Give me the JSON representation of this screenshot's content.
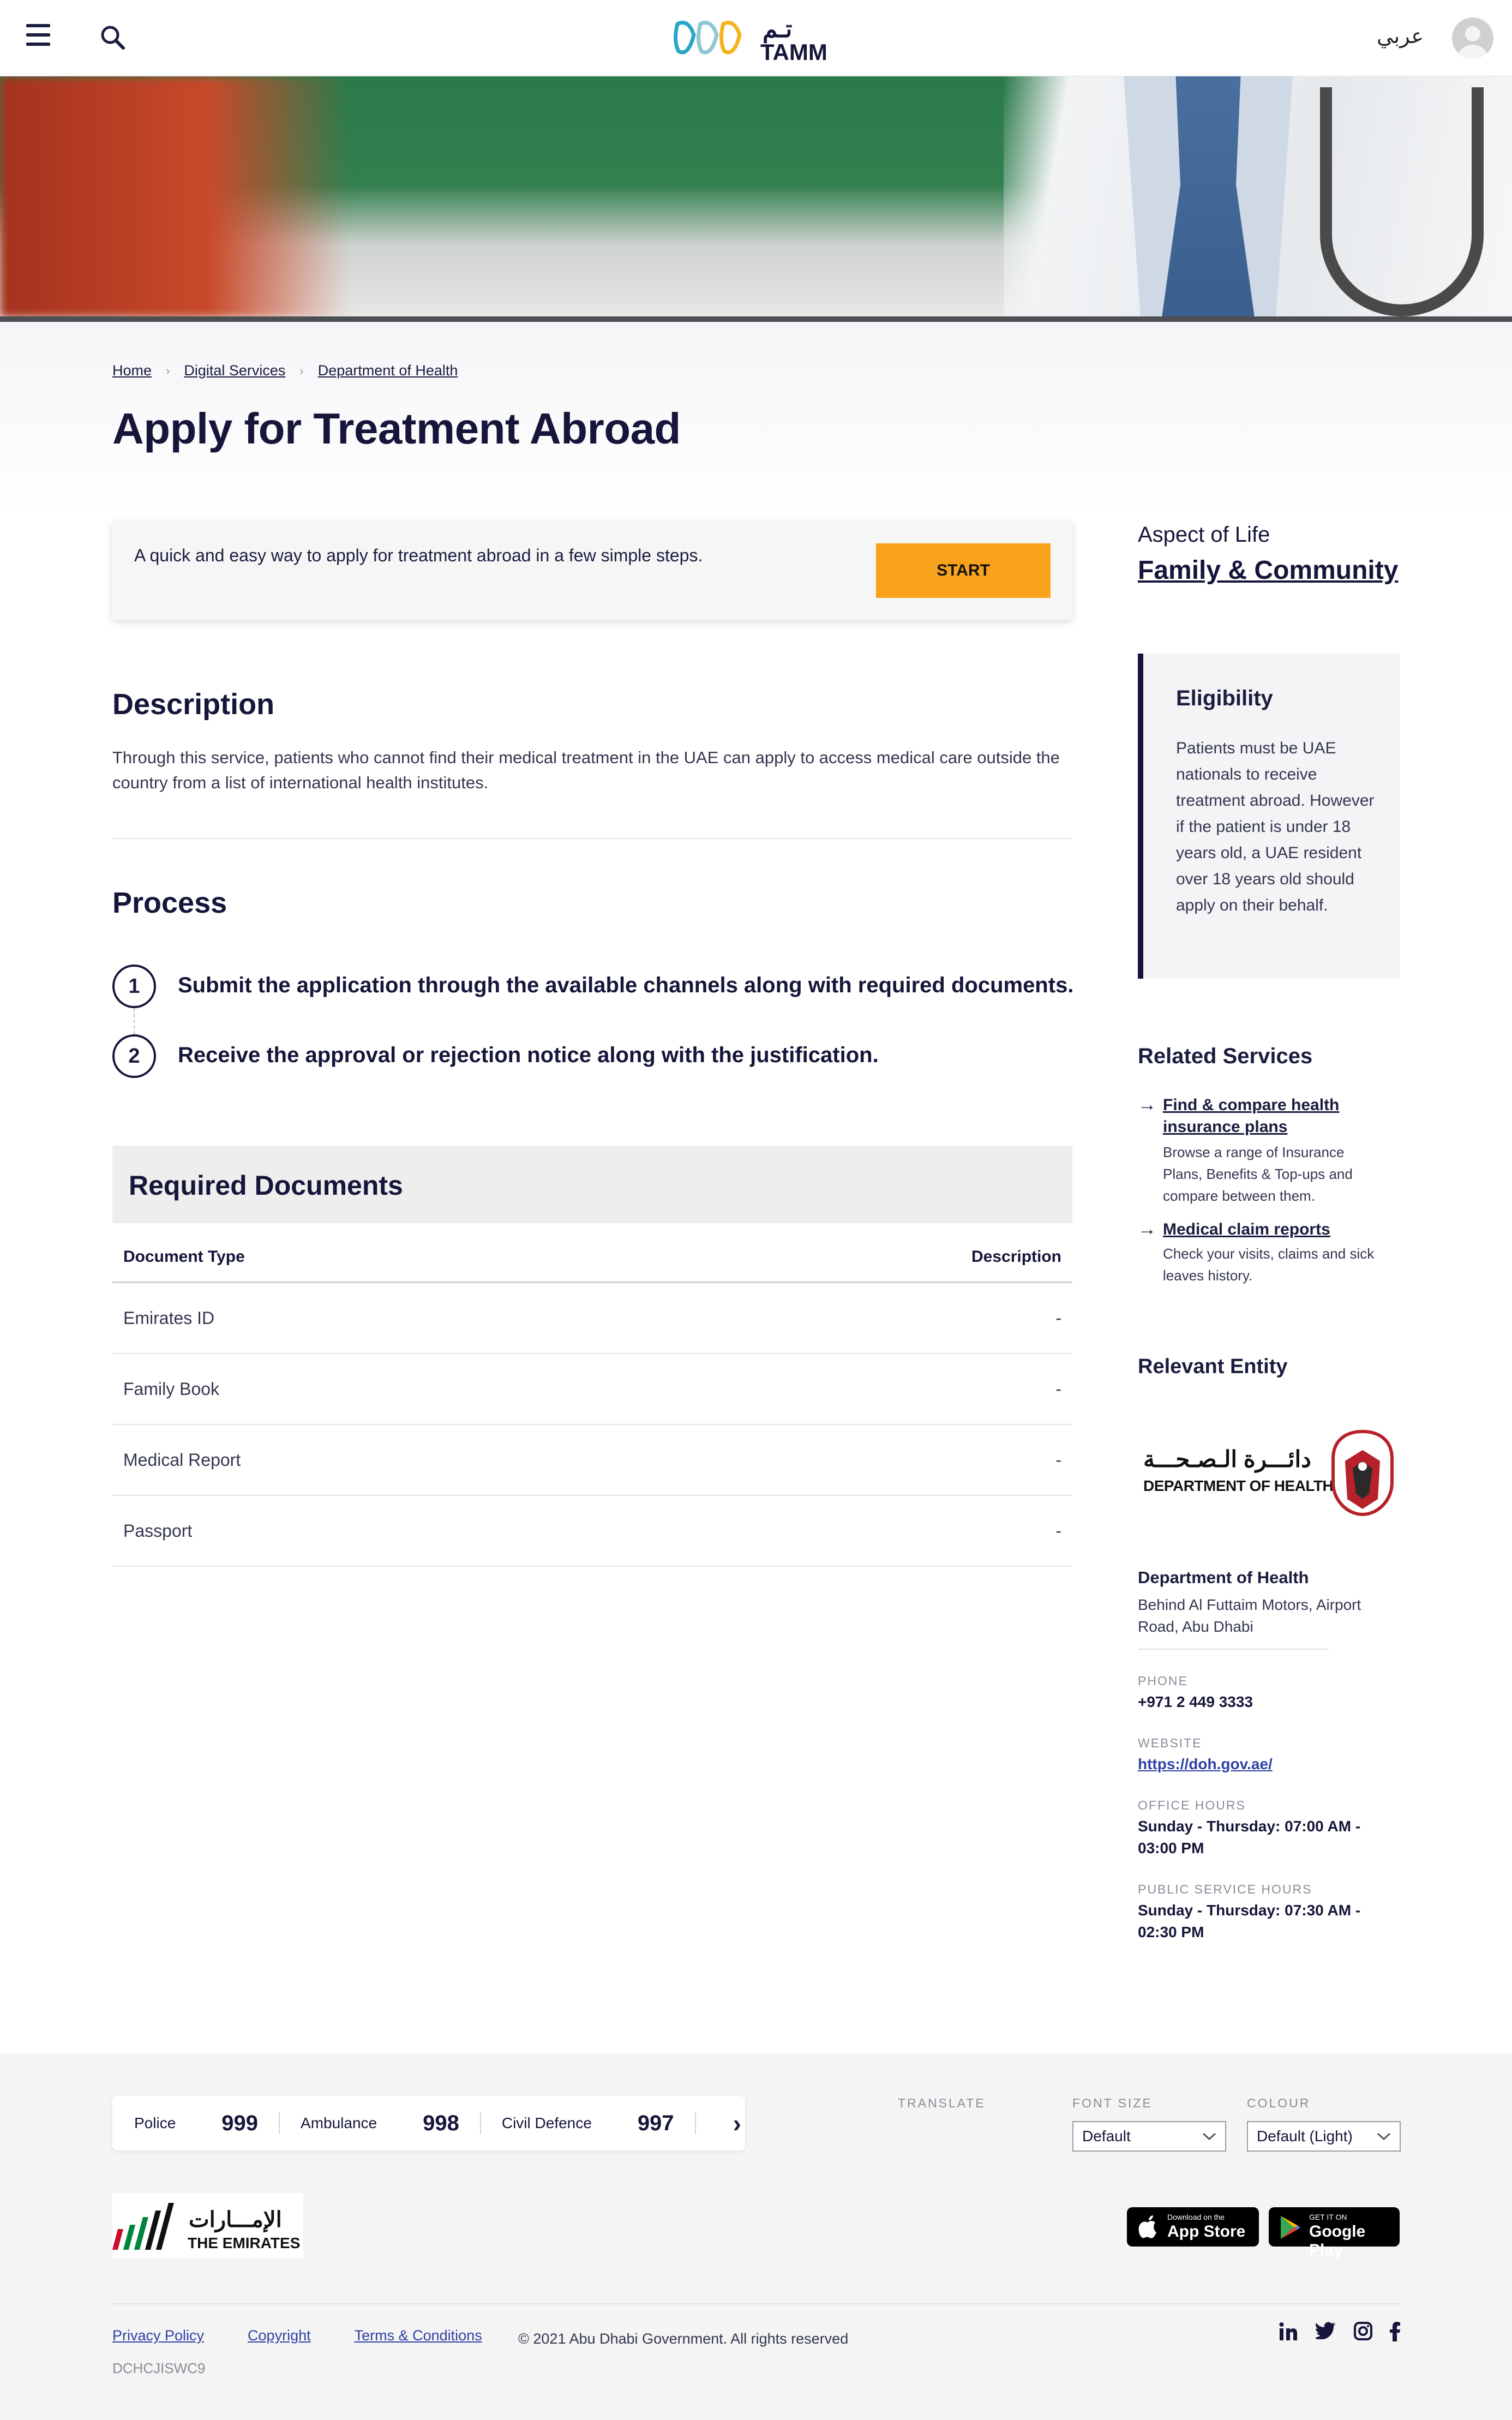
{
  "header": {
    "brand_arabic": "تـم",
    "brand": "TAMM",
    "language": "عربي"
  },
  "breadcrumb": [
    "Home",
    "Digital Services",
    "Department of Health"
  ],
  "page_title": "Apply for Treatment Abroad",
  "start_card": {
    "text": "A quick and easy way to apply for treatment abroad in a few simple steps.",
    "button": "START"
  },
  "description": {
    "heading": "Description",
    "text": "Through this service, patients who cannot find their medical treatment in the UAE can apply to access medical care outside the country from a list of international health institutes."
  },
  "process": {
    "heading": "Process",
    "steps": [
      {
        "number": "1",
        "text": "Submit the application through the available channels along with required documents."
      },
      {
        "number": "2",
        "text": "Receive the approval or rejection notice along with the justification."
      }
    ]
  },
  "required_documents": {
    "heading": "Required Documents",
    "columns": [
      "Document Type",
      "Description"
    ],
    "rows": [
      [
        "Emirates ID",
        "-"
      ],
      [
        "Family Book",
        "-"
      ],
      [
        "Medical Report",
        "-"
      ],
      [
        "Passport",
        "-"
      ]
    ]
  },
  "sidebar": {
    "aspect_label": "Aspect of Life",
    "aspect_value": "Family & Community",
    "eligibility": {
      "heading": "Eligibility",
      "text": "Patients must be UAE nationals to receive treatment abroad. However if the patient is under 18 years old, a UAE resident over 18 years old should apply on their behalf."
    },
    "related": {
      "heading": "Related Services",
      "items": [
        {
          "title": "Find & compare health insurance plans",
          "text": "Browse a range of Insurance Plans, Benefits & Top-ups and compare between them."
        },
        {
          "title": "Medical claim reports",
          "text": "Check your visits, claims and sick leaves history."
        }
      ]
    },
    "entity": {
      "heading": "Relevant Entity",
      "logo_arabic": "دائـــرة الـصـحـــة",
      "logo_english": "DEPARTMENT OF HEALTH",
      "name": "Department of Health",
      "address": "Behind Al Futtaim Motors, Airport Road, Abu Dhabi",
      "phone_label": "PHONE",
      "phone": "+971 2 449 3333",
      "website_label": "WEBSITE",
      "website": "https://doh.gov.ae/",
      "office_label": "OFFICE HOURS",
      "office": "Sunday - Thursday: 07:00 AM - 03:00 PM",
      "public_label": "PUBLIC SERVICE HOURS",
      "public": "Sunday - Thursday: 07:30 AM - 02:30 PM"
    }
  },
  "footer": {
    "emergency": [
      {
        "label": "Police",
        "number": "999"
      },
      {
        "label": "Ambulance",
        "number": "998"
      },
      {
        "label": "Civil Defence",
        "number": "997"
      }
    ],
    "translate_label": "TRANSLATE",
    "font_size_label": "FONT SIZE",
    "font_size_value": "Default",
    "colour_label": "COLOUR",
    "colour_value": "Default (Light)",
    "emirates_arabic": "الإمـــارات",
    "emirates_english": "THE EMIRATES",
    "app_store_small": "Download on the",
    "app_store": "App Store",
    "google_play_small": "GET IT ON",
    "google_play": "Google Play",
    "links": [
      "Privacy Policy",
      "Copyright",
      "Terms & Conditions"
    ],
    "copyright": "© 2021 Abu Dhabi Government. All rights reserved",
    "code": "DCHCJISWC9",
    "social": [
      "in",
      "t",
      "ig",
      "f"
    ]
  },
  "colors": {
    "navy": "#15163a",
    "accent": "#f9a21b",
    "link_blue": "#2f41a5"
  }
}
